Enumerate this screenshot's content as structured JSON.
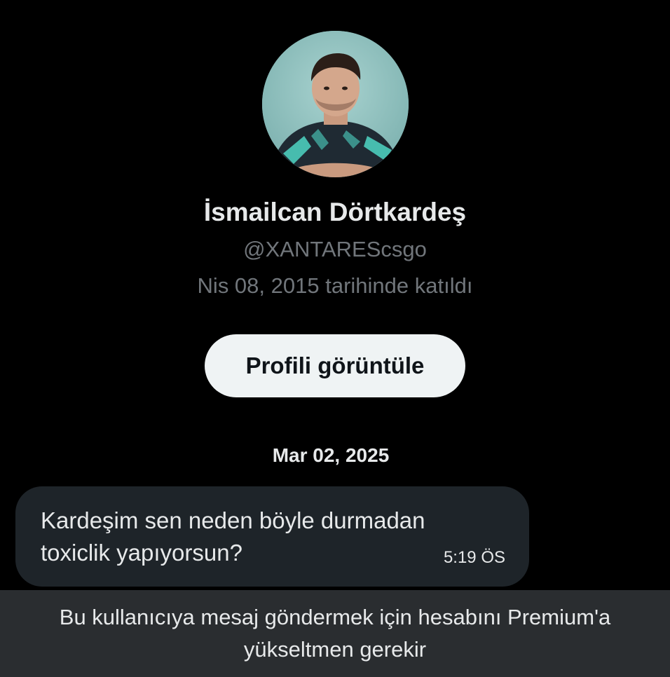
{
  "profile": {
    "display_name": "İsmailcan Dörtkardeş",
    "handle": "@XANTAREScsgo",
    "joined": "Nis 08, 2015 tarihinde katıldı",
    "view_profile_label": "Profili görüntüle"
  },
  "conversation": {
    "date": "Mar 02, 2025",
    "messages": [
      {
        "text": "Kardeşim sen neden böyle durmadan toxiclik yapıyorsun?",
        "time": "5:19 ÖS"
      }
    ]
  },
  "banner": {
    "text": "Bu kullanıcıya mesaj göndermek için hesabını Premium'a yükseltmen gerekir"
  },
  "colors": {
    "background": "#000000",
    "secondary_text": "#71767b",
    "bubble": "#1e2429",
    "button_bg": "#eff3f4",
    "banner_bg": "#2a2d30"
  }
}
